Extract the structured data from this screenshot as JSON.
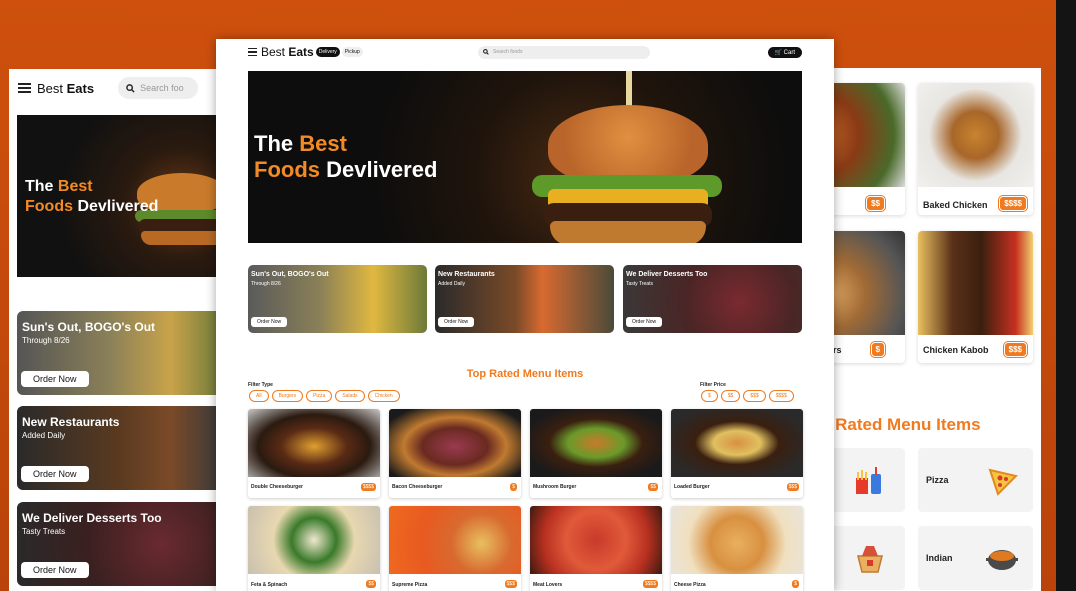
{
  "brand": {
    "prefix": "Best ",
    "bold": "Eats"
  },
  "colors": {
    "accent": "#f07a1f",
    "background": "#c2490b"
  },
  "left_mobile": {
    "search_placeholder": "Search foo",
    "hero": {
      "line1_white": "The ",
      "line1_orange": "Best",
      "line2_orange": "Foods",
      "line2_white": " Devlivered"
    },
    "cards": [
      {
        "title": "Sun's Out, BOGO's Out",
        "subtitle": "Through 8/26",
        "button": "Order Now"
      },
      {
        "title": "New Restaurants",
        "subtitle": "Added Daily",
        "button": "Order Now"
      },
      {
        "title": "We Deliver Desserts Too",
        "subtitle": "Tasty Treats",
        "button": "Order Now"
      }
    ]
  },
  "main": {
    "nav": {
      "delivery": "Delivery",
      "pickup": "Pickup",
      "search_placeholder": "Search foods",
      "cart": "Cart"
    },
    "hero": {
      "line1_white": "The ",
      "line1_orange": "Best",
      "line2_orange": "Foods",
      "line2_white": " Devlivered"
    },
    "promos": [
      {
        "title": "Sun's Out, BOGO's Out",
        "subtitle": "Through 8/26",
        "button": "Order Now"
      },
      {
        "title": "New Restaurants",
        "subtitle": "Added Daily",
        "button": "Order Now"
      },
      {
        "title": "We Deliver Desserts Too",
        "subtitle": "Tasty Treats",
        "button": "Order Now"
      }
    ],
    "section_title": "Top Rated Menu Items",
    "filter_type": {
      "label": "Filter Type",
      "options": [
        "All",
        "Burgers",
        "Pizza",
        "Salads",
        "Chicken"
      ]
    },
    "filter_price": {
      "label": "Filter Price",
      "options": [
        "$",
        "$$",
        "$$$",
        "$$$$"
      ]
    },
    "items": [
      {
        "name": "Double Cheeseburger",
        "price": "$$$$"
      },
      {
        "name": "Bacon Cheeseburger",
        "price": "$"
      },
      {
        "name": "Mushroom Burger",
        "price": "$$"
      },
      {
        "name": "Loaded Burger",
        "price": "$$$"
      },
      {
        "name": "Feta & Spinach",
        "price": "$$"
      },
      {
        "name": "Supreme Pizza",
        "price": "$$$"
      },
      {
        "name": "Meat Lovers",
        "price": "$$$$"
      },
      {
        "name": "Cheese Pizza",
        "price": "$"
      }
    ]
  },
  "right_mock": {
    "cards": [
      {
        "name": "",
        "price": "$$"
      },
      {
        "name": "Baked Chicken",
        "price": "$$$$"
      },
      {
        "name": "enders",
        "price": "$"
      },
      {
        "name": "Chicken Kabob",
        "price": "$$$"
      }
    ],
    "section_title": "p Rated Menu Items",
    "categories": [
      {
        "name": "d"
      },
      {
        "name": "Pizza"
      },
      {
        "name": ""
      },
      {
        "name": "Indian"
      }
    ]
  }
}
